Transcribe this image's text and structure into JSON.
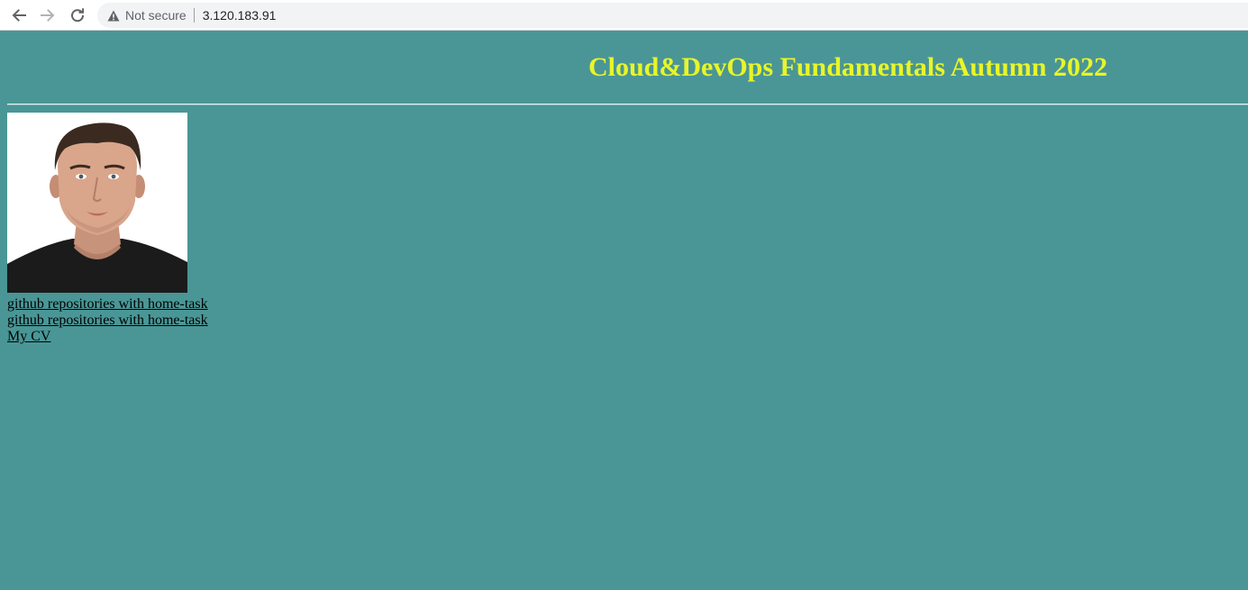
{
  "browser": {
    "security_label": "Not secure",
    "url": "3.120.183.91"
  },
  "page": {
    "title": "Cloud&DevOps Fundamentals Autumn 2022",
    "background_color": "#4a9696",
    "title_color": "#e8f529",
    "links": [
      {
        "label": "github repositories with home-task"
      },
      {
        "label": "github repositories with home-task"
      },
      {
        "label": "My CV"
      }
    ]
  }
}
